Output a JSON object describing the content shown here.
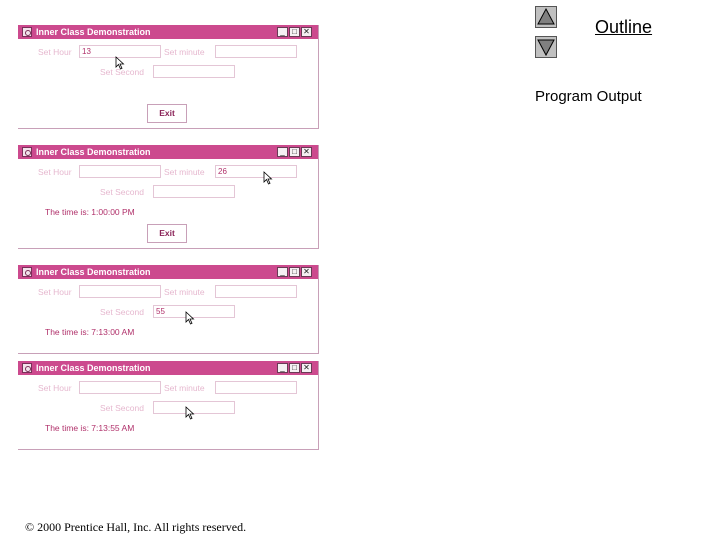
{
  "sidebar": {
    "up_icon": "triangle-up",
    "down_icon": "triangle-down",
    "outline_label": "Outline",
    "program_output_label": "Program Output"
  },
  "windows": [
    {
      "title": "Inner Class Demonstration",
      "labels": {
        "hour": "Set Hour",
        "minute": "Set minute",
        "second": "Set Second"
      },
      "values": {
        "hour": "13",
        "minute": "",
        "second": ""
      },
      "time_text": "",
      "exit_label": "Exit"
    },
    {
      "title": "Inner Class Demonstration",
      "labels": {
        "hour": "Set Hour",
        "minute": "Set minute",
        "second": "Set Second"
      },
      "values": {
        "hour": "",
        "minute": "26",
        "second": ""
      },
      "time_text": "The time is: 1:00:00 PM",
      "exit_label": "Exit"
    },
    {
      "title": "Inner Class Demonstration",
      "labels": {
        "hour": "Set Hour",
        "minute": "Set minute",
        "second": "Set Second"
      },
      "values": {
        "hour": "",
        "minute": "",
        "second": "55"
      },
      "time_text": "The time is: 7:13:00 AM",
      "exit_label": ""
    },
    {
      "title": "Inner Class Demonstration",
      "labels": {
        "hour": "Set Hour",
        "minute": "Set minute",
        "second": "Set Second"
      },
      "values": {
        "hour": "",
        "minute": "",
        "second": ""
      },
      "time_text": "The time is: 7:13:55 AM",
      "exit_label": ""
    }
  ],
  "footer": {
    "copyright": "© 2000 Prentice Hall, Inc.  All rights reserved."
  },
  "colors": {
    "titlebar": "#cc4a8e",
    "label": "#e6b8cf",
    "value_text": "#b0306a"
  }
}
